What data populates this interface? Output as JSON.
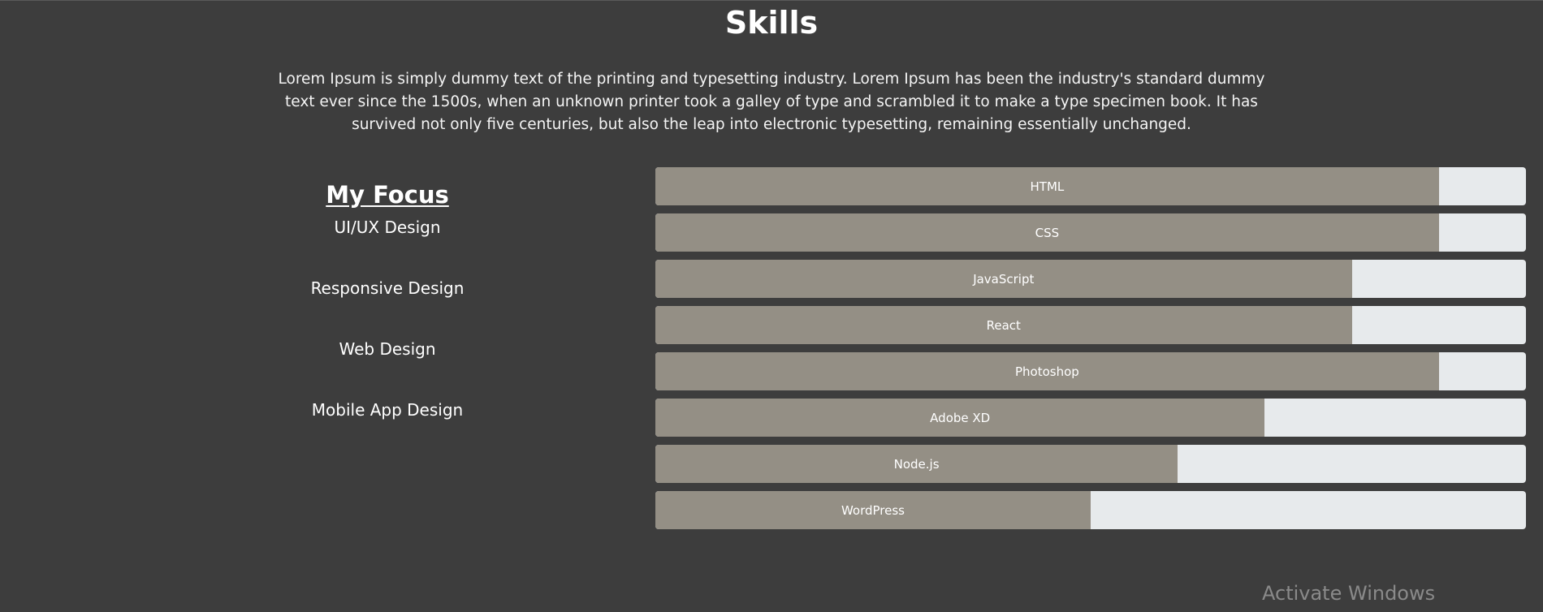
{
  "header": {
    "title": "Skills",
    "intro": "Lorem Ipsum is simply dummy text of the printing and typesetting industry. Lorem Ipsum has been the industry's standard dummy text ever since the 1500s, when an unknown printer took a galley of type and scrambled it to make a type specimen book. It has survived not only five centuries, but also the leap into electronic typesetting, remaining essentially unchanged."
  },
  "focus": {
    "title": "My Focus",
    "items": [
      "UI/UX Design",
      "Responsive Design",
      "Web Design",
      "Mobile App Design"
    ]
  },
  "skills": [
    {
      "name": "HTML",
      "level": 0.9
    },
    {
      "name": "CSS",
      "level": 0.9
    },
    {
      "name": "JavaScript",
      "level": 0.8
    },
    {
      "name": "React",
      "level": 0.8
    },
    {
      "name": "Photoshop",
      "level": 0.9
    },
    {
      "name": "Adobe XD",
      "level": 0.7
    },
    {
      "name": "Node.js",
      "level": 0.6
    },
    {
      "name": "WordPress",
      "level": 0.5
    }
  ],
  "colors": {
    "background": "#3d3d3d",
    "bar_fill": "#948f85",
    "bar_track": "#e7eaec"
  },
  "watermark": "Activate Windows"
}
